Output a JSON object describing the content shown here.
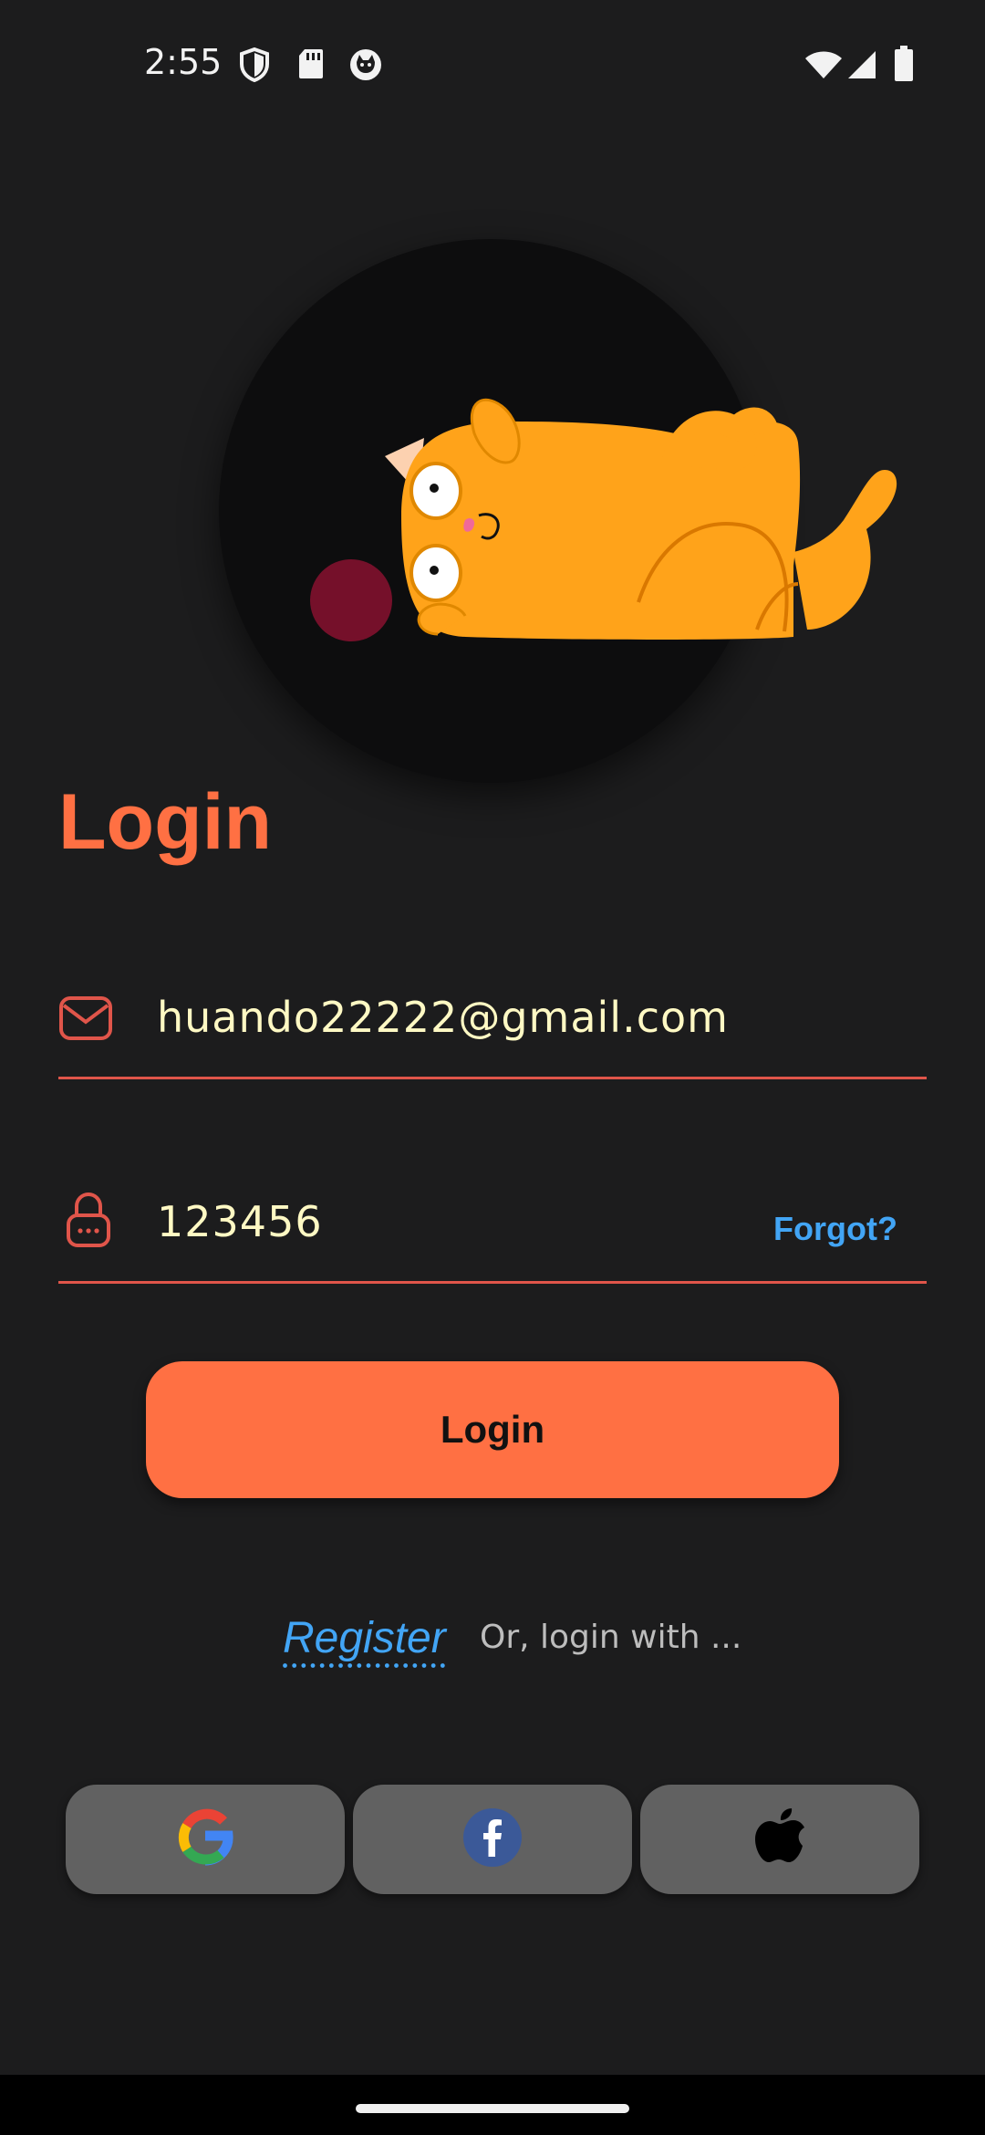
{
  "status_bar": {
    "time": "2:55",
    "left_icons": [
      "shield-icon",
      "sd-card-icon",
      "cat-face-icon"
    ],
    "right_icons": [
      "wifi-icon",
      "signal-icon",
      "battery-icon"
    ]
  },
  "hero": {
    "illustration": "cat-playing-with-ball"
  },
  "page": {
    "title": "Login"
  },
  "email": {
    "icon": "mail-icon",
    "value": "huando22222@gmail.com"
  },
  "password": {
    "icon": "lock-icon",
    "value": "123456",
    "forgot_label": "Forgot?"
  },
  "actions": {
    "login_label": "Login",
    "register_label": "Register",
    "alt_login_text": "Or, login with ..."
  },
  "social": [
    "google-icon",
    "facebook-icon",
    "apple-icon"
  ],
  "colors": {
    "background": "#1c1c1d",
    "accent": "#ff7043",
    "link": "#42a5f5",
    "field_line": "#e0554a",
    "input_text": "#fff9c4",
    "social_button": "#616161"
  }
}
